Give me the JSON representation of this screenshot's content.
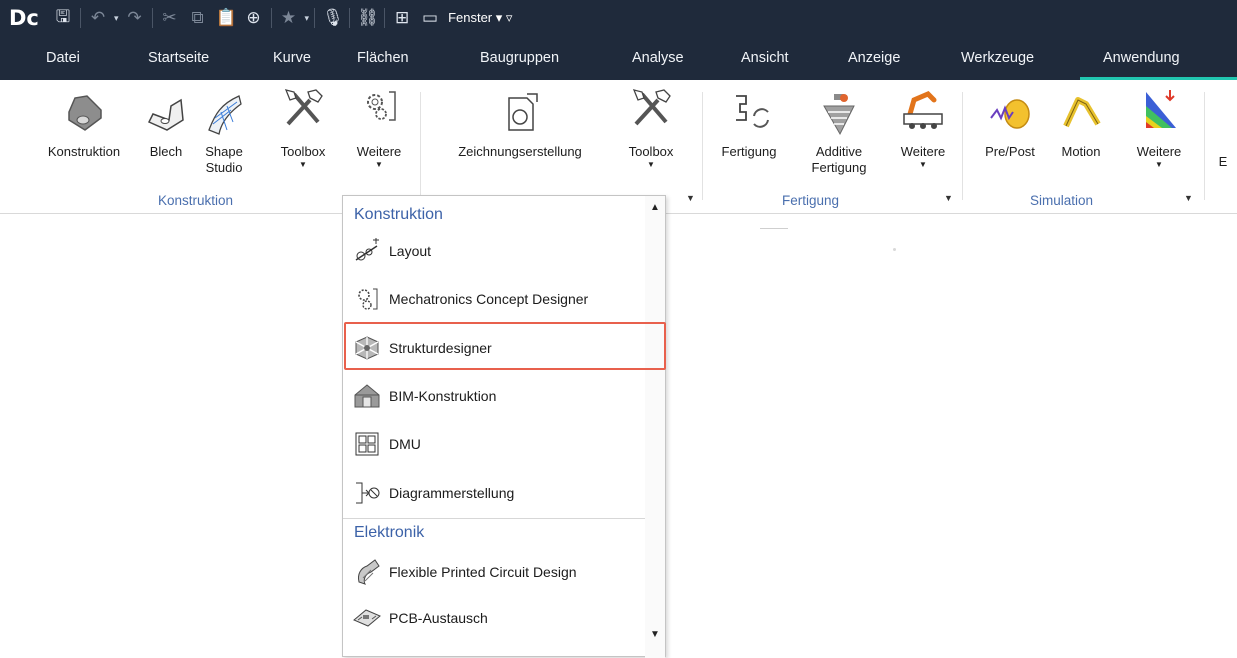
{
  "app": {
    "logo": "Dc",
    "window_menu": "Fenster ▾ ▿"
  },
  "qat_icons": [
    "save-icon",
    "undo-icon",
    "redo-icon",
    "cut-icon",
    "copy-icon",
    "paste-icon",
    "move-icon",
    "favorite-icon",
    "microphone-icon",
    "link-icon",
    "window-icon",
    "fullscreen-icon"
  ],
  "tabs": [
    "Datei",
    "Startseite",
    "Kurve",
    "Flächen",
    "Baugruppen",
    "Analyse",
    "Ansicht",
    "Anzeige",
    "Werkzeuge",
    "Anwendung"
  ],
  "active_tab": "Anwendung",
  "ribbon": {
    "buttons": {
      "konstruktion": "Konstruktion",
      "blech": "Blech",
      "shape1": "Shape",
      "shape2": "Studio",
      "toolbox1": "Toolbox",
      "weitere1": "Weitere",
      "zeichnung": "Zeichnungserstellung",
      "toolbox2": "Toolbox",
      "fertigung": "Fertigung",
      "additive1": "Additive",
      "additive2": "Fertigung",
      "weitere2": "Weitere",
      "prepost": "Pre/Post",
      "motion": "Motion",
      "weitere3": "Weitere",
      "cut_e": "E"
    },
    "groups": {
      "konstruktion": "Konstruktion",
      "fertigung": "Fertigung",
      "simulation": "Simulation"
    }
  },
  "dropdown": {
    "categories": [
      "Konstruktion",
      "Elektronik"
    ],
    "items": [
      "Layout",
      "Mechatronics Concept Designer",
      "Strukturdesigner",
      "BIM-Konstruktion",
      "DMU",
      "Diagrammerstellung",
      "Flexible Printed Circuit Design",
      "PCB-Austausch"
    ],
    "highlighted": "Strukturdesigner"
  },
  "colors": {
    "title_bar": "#1f2a3b",
    "active_tab_underline": "#21c6b0",
    "group_label": "#4a6fae",
    "highlight_box": "#e8604c"
  }
}
